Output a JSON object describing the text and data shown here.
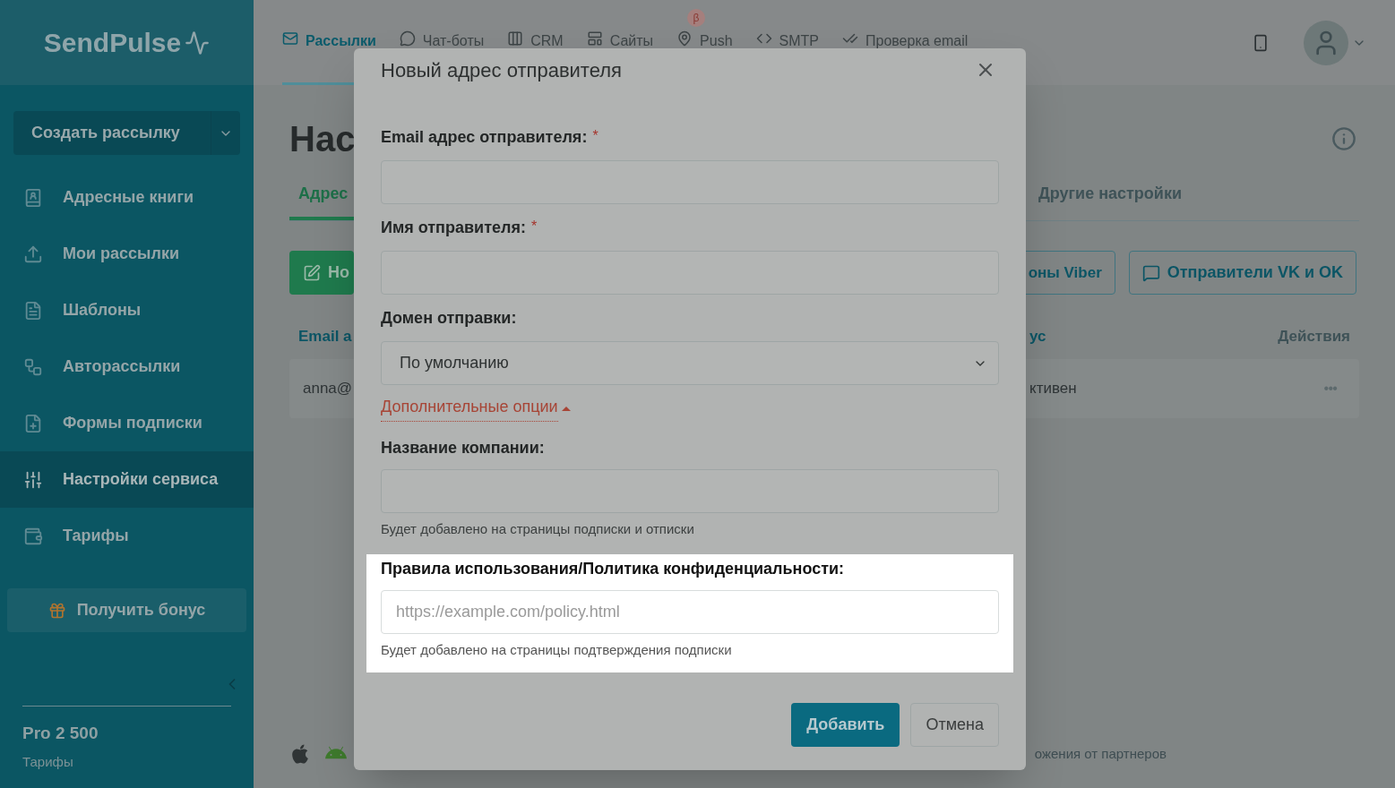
{
  "sidebar": {
    "logo": "SendPulse",
    "create_button": "Создать рассылку",
    "items": [
      {
        "label": "Адресные книги",
        "selected": false
      },
      {
        "label": "Мои рассылки",
        "selected": false
      },
      {
        "label": "Шаблоны",
        "selected": false
      },
      {
        "label": "Авторассылки",
        "selected": false
      },
      {
        "label": "Формы подписки",
        "selected": false
      },
      {
        "label": "Настройки сервиса",
        "selected": true
      },
      {
        "label": "Тарифы",
        "selected": false
      }
    ],
    "bonus_button": "Получить бонус",
    "plan": "Pro 2 500",
    "plan_link": "Тарифы"
  },
  "top_nav": {
    "items": [
      {
        "label": "Рассылки",
        "selected": true
      },
      {
        "label": "Чат-боты",
        "selected": false
      },
      {
        "label": "CRM",
        "selected": false
      },
      {
        "label": "Сайты",
        "selected": false
      },
      {
        "label": "Push",
        "selected": false
      },
      {
        "label": "SMTP",
        "selected": false
      },
      {
        "label": "Проверка email",
        "selected": false
      }
    ],
    "beta_badge": "β"
  },
  "page": {
    "title": "Нас",
    "tabs": [
      {
        "label": "Адрес",
        "selected": true
      },
      {
        "label": "Другие настройки",
        "selected": false
      }
    ],
    "new_button": "Но",
    "viber_button": "оны Viber",
    "vk_button": "Отправители VK и OK",
    "columns": [
      "Email а",
      "ус",
      "Действия"
    ],
    "row": [
      "anna@",
      "ктивен",
      "•••"
    ],
    "footer": "ожения от партнеров"
  },
  "modal": {
    "title": "Новый адрес отправителя",
    "required_mark": "*",
    "fields": [
      {
        "kind": "input",
        "label": "Email адрес отправителя:",
        "required": true
      },
      {
        "kind": "input",
        "label": "Имя отправителя:",
        "required": true
      },
      {
        "kind": "select",
        "label": "Домен отправки:",
        "value": "По умолчанию",
        "required": false
      }
    ],
    "options_link": "Дополнительные опции",
    "options_expanded": true,
    "extra_fields": [
      {
        "label": "Название компании:",
        "hint": "Будет добавлено на страницы подписки и отписки",
        "highlighted": false
      },
      {
        "label": "Правила использования/Политика конфиденциальности:",
        "placeholder": "https://example.com/policy.html",
        "hint": "Будет добавлено на страницы подтверждения подписки",
        "highlighted": true
      }
    ],
    "primary_button": "Добавить",
    "cancel_button": "Отмена"
  }
}
